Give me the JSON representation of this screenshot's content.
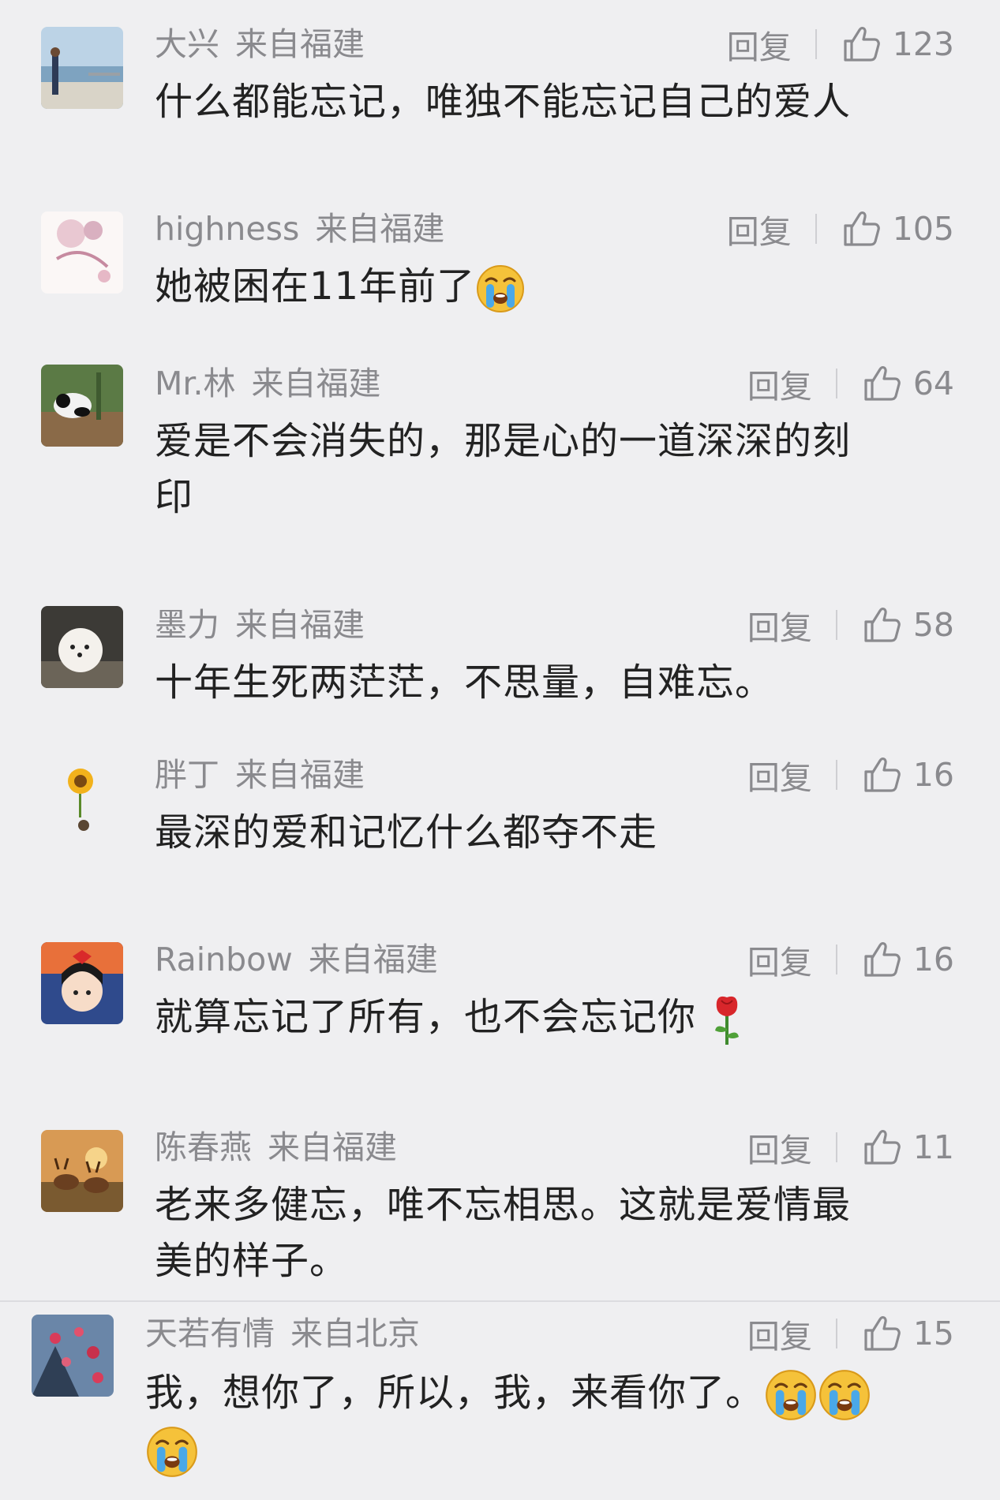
{
  "comments": [
    {
      "user": "大兴",
      "location": "来自福建",
      "reply": "回复",
      "likes": "123",
      "text": "什么都能忘记，唯独不能忘记自己的爱人"
    },
    {
      "user": "highness",
      "location": "来自福建",
      "reply": "回复",
      "likes": "105",
      "text": "她被困在11年前了"
    },
    {
      "user": "Mr.林",
      "location": "来自福建",
      "reply": "回复",
      "likes": "64",
      "text": "爱是不会消失的，那是心的一道深深的刻",
      "text2": "印"
    },
    {
      "user": "墨力",
      "location": "来自福建",
      "reply": "回复",
      "likes": "58",
      "text": "十年生死两茫茫，不思量，自难忘。"
    },
    {
      "user": "胖丁",
      "location": "来自福建",
      "reply": "回复",
      "likes": "16",
      "text": "最深的爱和记忆什么都夺不走"
    },
    {
      "user": "Rainbow",
      "location": "来自福建",
      "reply": "回复",
      "likes": "16",
      "text": "就算忘记了所有，也不会忘记你"
    },
    {
      "user": "陈春燕",
      "location": "来自福建",
      "reply": "回复",
      "likes": "11",
      "text": "老来多健忘，唯不忘相思。这就是爱情最",
      "text2": "美的样子。"
    },
    {
      "user": "天若有情",
      "location": "来自北京",
      "reply": "回复",
      "likes": "15",
      "text": "我，想你了，所以，我，来看你了。"
    }
  ],
  "colors": {
    "background": "#efeff1",
    "meta_text": "#8a8a8e",
    "body_text": "#222222",
    "emoji_face": "#f5c23a",
    "emoji_tears": "#4aa8e8",
    "rose": "#d8262b"
  },
  "icons": [
    "thumbs-up-icon",
    "crying-face-emoji",
    "rose-emoji"
  ]
}
